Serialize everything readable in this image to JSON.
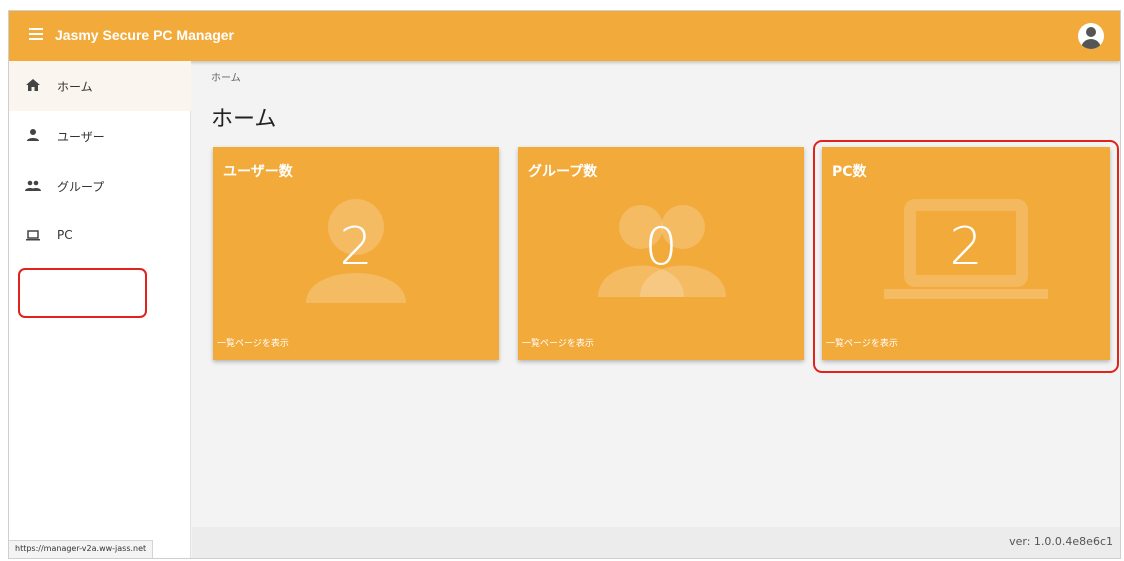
{
  "app": {
    "title": "Jasmy Secure PC Manager"
  },
  "sidebar": {
    "items": [
      {
        "label": "ホーム",
        "icon": "home-icon"
      },
      {
        "label": "ユーザー",
        "icon": "person-icon"
      },
      {
        "label": "グループ",
        "icon": "group-icon"
      },
      {
        "label": "PC",
        "icon": "laptop-icon"
      }
    ],
    "status_url": "https://manager-v2a.ww-jass.net"
  },
  "main": {
    "breadcrumb": "ホーム",
    "title": "ホーム",
    "cards": [
      {
        "title": "ユーザー数",
        "count": "2",
        "link": "一覧ページを表示",
        "icon": "person-icon"
      },
      {
        "title": "グループ数",
        "count": "0",
        "link": "一覧ページを表示",
        "icon": "group-icon"
      },
      {
        "title": "PC数",
        "count": "2",
        "link": "一覧ページを表示",
        "icon": "laptop-icon"
      }
    ]
  },
  "footer": {
    "version": "ver: 1.0.0.4e8e6c1"
  },
  "colors": {
    "accent": "#f2aa3b",
    "highlight": "#e0241c"
  }
}
